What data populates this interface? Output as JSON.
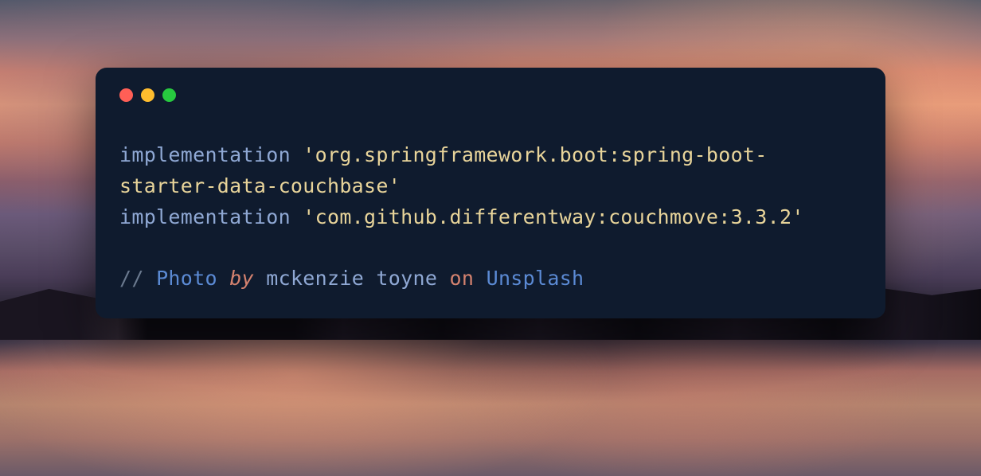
{
  "window": {
    "control_red": "close",
    "control_yellow": "minimize",
    "control_green": "zoom"
  },
  "code": {
    "line1": {
      "keyword": "implementation",
      "string": "'org.springframework.boot:spring-boot-starter-data-couchbase'"
    },
    "line2": {
      "keyword": "implementation",
      "string": "'com.github.differentway:couchmove:3.3.2'"
    },
    "comment": {
      "slashes": "//",
      "photo": "Photo",
      "by": "by",
      "author": "mckenzie toyne",
      "on": "on",
      "site": "Unsplash"
    }
  }
}
